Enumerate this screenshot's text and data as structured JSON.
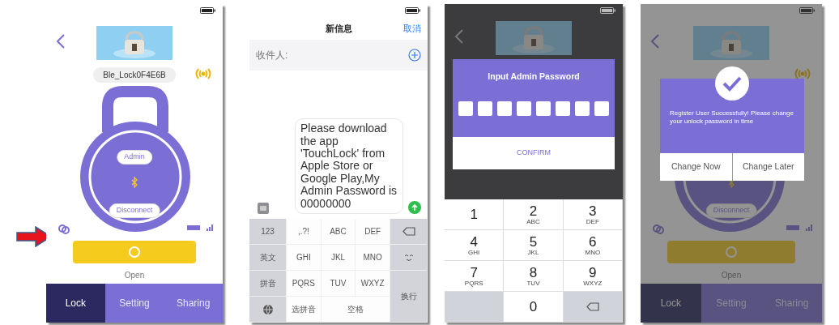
{
  "lock_screen": {
    "device_name": "Ble_Lock0F4E6B",
    "admin_label": "Admin",
    "disconnect_label": "Disconnect",
    "open_label": "Open",
    "tabs": [
      {
        "label": "Lock",
        "selected": true
      },
      {
        "label": "Setting",
        "selected": false
      },
      {
        "label": "Sharing",
        "selected": false
      }
    ]
  },
  "message_screen": {
    "title": "新信息",
    "cancel": "取消",
    "recipient_placeholder": "收件人:",
    "message": "Please download the app 'TouchLock' from Apple Store or Google Play,My Admin Password is 00000000",
    "keys": [
      {
        "kind": "function",
        "label": "123"
      },
      {
        "kind": "letter",
        "label": ",.?!"
      },
      {
        "kind": "letter",
        "label": "ABC"
      },
      {
        "kind": "letter",
        "label": "DEF"
      },
      {
        "kind": "backspace"
      },
      {
        "kind": "function",
        "label": "英文"
      },
      {
        "kind": "letter",
        "label": "GHI"
      },
      {
        "kind": "letter",
        "label": "JKL"
      },
      {
        "kind": "letter",
        "label": "MNO"
      },
      {
        "kind": "emoji"
      },
      {
        "kind": "function",
        "label": "拼音"
      },
      {
        "kind": "letter",
        "label": "PQRS"
      },
      {
        "kind": "letter",
        "label": "TUV"
      },
      {
        "kind": "letter",
        "label": "WXYZ"
      },
      {
        "kind": "return",
        "label": "换行"
      },
      {
        "kind": "globe"
      },
      {
        "kind": "letter",
        "label": "选拼音"
      },
      {
        "kind": "space",
        "label": "空格"
      }
    ]
  },
  "password_screen": {
    "title": "Input Admin Password",
    "confirm": "CONFIRM",
    "code_boxes": [
      {
        "filled": false
      },
      {
        "filled": false
      },
      {
        "filled": false
      },
      {
        "filled": false
      },
      {
        "filled": false
      },
      {
        "filled": false
      },
      {
        "filled": false
      },
      {
        "filled": false
      }
    ],
    "keys": [
      {
        "kind": "digit",
        "digit": "1"
      },
      {
        "kind": "digit",
        "digit": "2",
        "letters": "ABC"
      },
      {
        "kind": "digit",
        "digit": "3",
        "letters": "DEF"
      },
      {
        "kind": "digit",
        "digit": "4",
        "letters": "GHI"
      },
      {
        "kind": "digit",
        "digit": "5",
        "letters": "JKL"
      },
      {
        "kind": "digit",
        "digit": "6",
        "letters": "MNO"
      },
      {
        "kind": "digit",
        "digit": "7",
        "letters": "PQRS"
      },
      {
        "kind": "digit",
        "digit": "8",
        "letters": "TUV"
      },
      {
        "kind": "digit",
        "digit": "9",
        "letters": "WXYZ"
      },
      {
        "kind": "blank"
      },
      {
        "kind": "digit",
        "digit": "0"
      },
      {
        "kind": "backspace"
      }
    ]
  },
  "success_screen": {
    "message": "Register User Successfully! Please change your unlock password in time",
    "buttons": [
      "Change Now",
      "Change Later"
    ],
    "disconnect_label": "Disconnect",
    "open_label": "Open",
    "tabs": [
      {
        "label": "Lock",
        "selected": true
      },
      {
        "label": "Setting",
        "selected": false
      },
      {
        "label": "Sharing",
        "selected": false
      }
    ]
  }
}
